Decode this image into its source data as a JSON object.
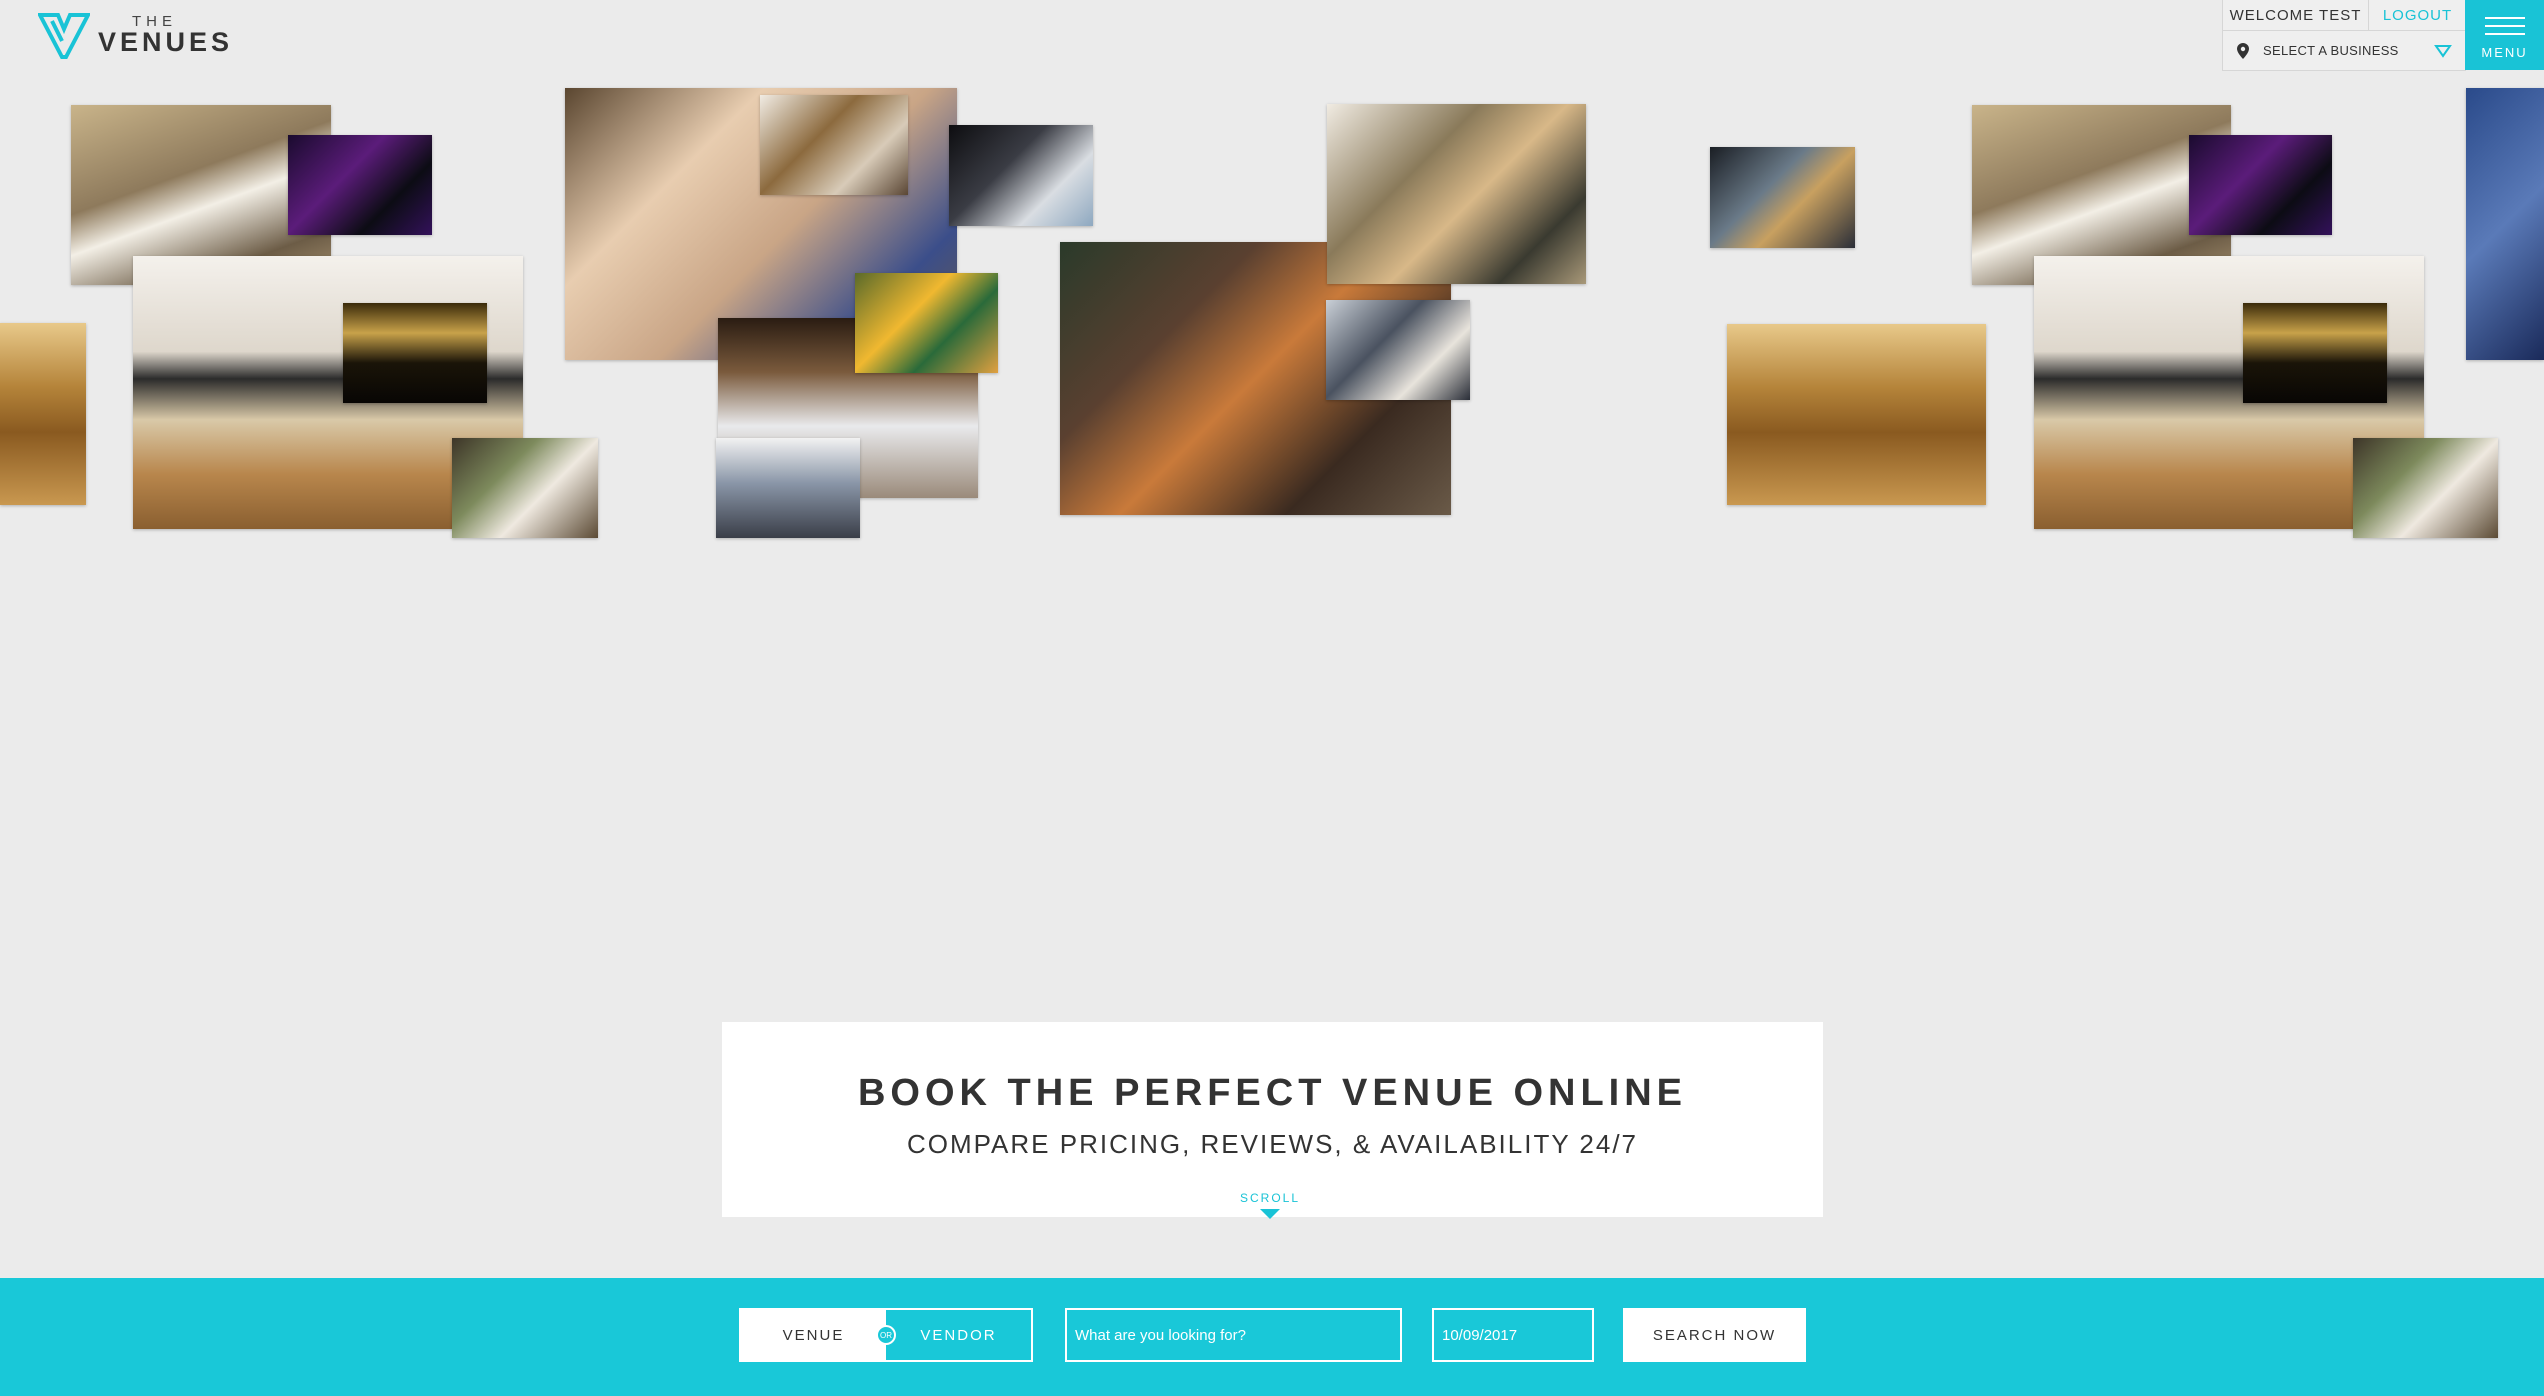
{
  "brand": {
    "small": "THE",
    "big": "VENUES",
    "accent": "#19c3d6"
  },
  "account": {
    "welcome": "WELCOME TEST",
    "logout": "LOGOUT",
    "business_select": "SELECT A BUSINESS"
  },
  "menu": {
    "label": "MENU"
  },
  "hero": {
    "title": "BOOK THE PERFECT VENUE ONLINE",
    "subtitle": "COMPARE PRICING, REVIEWS, & AVAILABILITY 24/7",
    "scroll": "SCROLL"
  },
  "search": {
    "toggle": {
      "venue": "VENUE",
      "or": "OR",
      "vendor": "VENDOR",
      "selected": "VENUE"
    },
    "query_placeholder": "What are you looking for?",
    "date_value": "10/09/2017",
    "button": "SEARCH NOW",
    "bar_color": "#19c8d8"
  },
  "collage": [
    "wedding photographer",
    "dj",
    "waiter with canapes",
    "concert crowd",
    "bride",
    "auditorium hall",
    "friends toasting",
    "dinner party",
    "chauffeur",
    "banquet hall",
    "conference",
    "florist",
    "guitarist",
    "buffet",
    "meeting",
    "canapes"
  ]
}
